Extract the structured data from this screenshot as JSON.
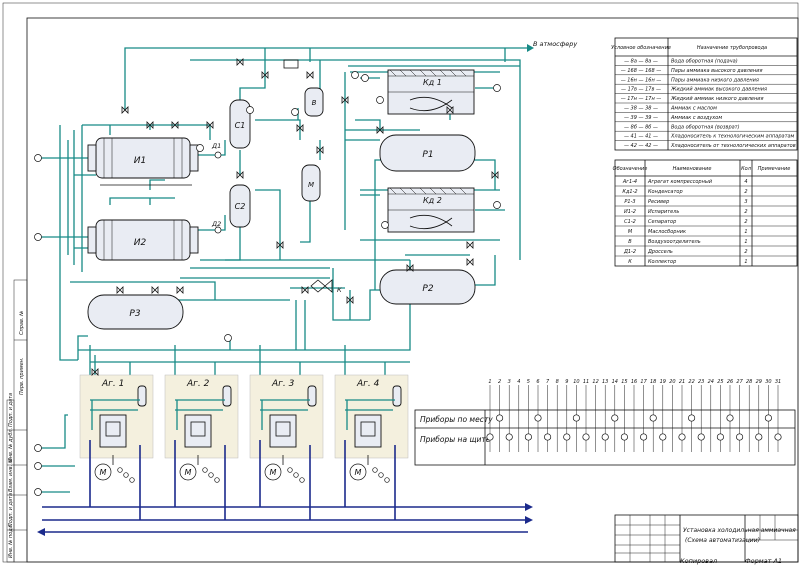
{
  "top_line_label": "В атмосферу",
  "equipment": {
    "I1": "И1",
    "I2": "И2",
    "C1": "С1",
    "C2": "С2",
    "D1": "Д1",
    "D2": "Д2",
    "V": "В",
    "M": "М",
    "K": "К",
    "R1": "Р1",
    "R2": "Р2",
    "R3": "Р3",
    "KD1": "Кд 1",
    "KD2": "Кд 2",
    "aggregates": [
      "Аг. 1",
      "Аг. 2",
      "Аг. 3",
      "Аг. 4"
    ],
    "motor": "М"
  },
  "legend": {
    "header": [
      "Условное обозначение",
      "Назначение трубопровода"
    ],
    "rows": [
      {
        "code": "— 8а — 8а —",
        "text": "Вода оборотная (подача)"
      },
      {
        "code": "— 168 — 168 —",
        "text": "Пары аммиака высокого давления"
      },
      {
        "code": "— 16н — 16н —",
        "text": "Пары аммиака низкого давления"
      },
      {
        "code": "— 17в — 17в —",
        "text": "Жидкий аммиак высокого давления"
      },
      {
        "code": "— 17н — 17н —",
        "text": "Жидкий аммиак низкого давления"
      },
      {
        "code": "— 38 — 38 —",
        "text": "Аммиак с маслом"
      },
      {
        "code": "— 39 — 39 —",
        "text": "Аммиак с воздухом"
      },
      {
        "code": "— 8б — 8б —",
        "text": "Вода оборотная (возврат)"
      },
      {
        "code": "— 41 — 41 —",
        "text": "Хладоноситель к технологическим аппаратам"
      },
      {
        "code": "— 42 — 42 —",
        "text": "Хладоноситель от технологических аппаратов"
      }
    ]
  },
  "spec": {
    "header": [
      "Обозначение",
      "Наименование",
      "Кол",
      "Примечание"
    ],
    "rows": [
      {
        "code": "Аг1-4",
        "name": "Агрегат компрессорный",
        "qty": "4"
      },
      {
        "code": "Кд1-2",
        "name": "Конденсатор",
        "qty": "2"
      },
      {
        "code": "Р1-3",
        "name": "Ресивер",
        "qty": "3"
      },
      {
        "code": "И1-2",
        "name": "Испаритель",
        "qty": "2"
      },
      {
        "code": "С1-2",
        "name": "Сепаратор",
        "qty": "2"
      },
      {
        "code": "М",
        "name": "Маслосборник",
        "qty": "1"
      },
      {
        "code": "В",
        "name": "Воздухоотделитель",
        "qty": "1"
      },
      {
        "code": "Д1-2",
        "name": "Дроссель",
        "qty": "2"
      },
      {
        "code": "К",
        "name": "Коллектор",
        "qty": "1"
      }
    ]
  },
  "instruments": {
    "numbers": [
      "1",
      "2",
      "3",
      "4",
      "5",
      "6",
      "7",
      "8",
      "9",
      "10",
      "11",
      "12",
      "13",
      "14",
      "15",
      "16",
      "17",
      "18",
      "19",
      "20",
      "21",
      "22",
      "23",
      "24",
      "25",
      "26",
      "27",
      "28",
      "29",
      "30",
      "31"
    ],
    "row_local": "Приборы по месту",
    "row_panel": "Приборы на щите"
  },
  "title_block": {
    "title": "Установка холодильная аммиачная",
    "subtitle": "(Схема автоматизации)",
    "bottom_left": "Копировал",
    "bottom_right": "Формат А1"
  },
  "left_margin": [
    "Инв. № подл.",
    "Подп. и дата",
    "Взам. инв. №",
    "Инв. № дубл.",
    "Подп. и дата",
    "Справ. №",
    "Перв. примен."
  ]
}
